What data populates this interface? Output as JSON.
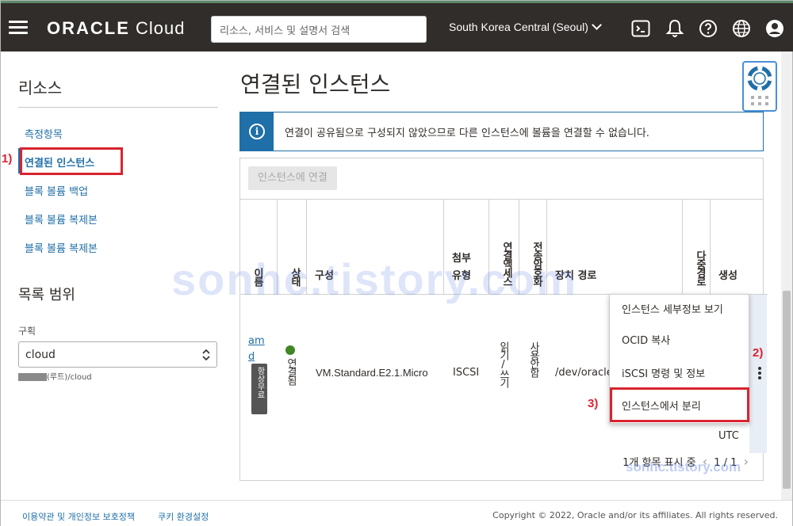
{
  "header": {
    "logo_bold": "ORACLE",
    "logo_light": "Cloud",
    "search_placeholder": "리소스, 서비스 및 설명서 검색",
    "region": "South Korea Central (Seoul)"
  },
  "sidebar": {
    "title": "리소스",
    "items": [
      {
        "label": "측정항목"
      },
      {
        "label": "연결된 인스턴스"
      },
      {
        "label": "블록 볼륨 백업"
      },
      {
        "label": "블록 볼륨 복제본"
      },
      {
        "label": "블록 볼륨 복제본"
      }
    ],
    "scope_title": "목록 범위",
    "compartment_label": "구획",
    "compartment_value": "cloud",
    "compartment_path": "(루트)/cloud"
  },
  "main": {
    "title": "연결된 인스턴스",
    "info_message": "연결이 공유됨으로 구성되지 않았으므로 다른 인스턴스에 볼륨을 연결할 수 없습니다.",
    "attach_button": "인스턴스에 연결",
    "columns": {
      "name": "이름",
      "state": "상태",
      "shape": "구성",
      "attachment_type": "첨부 유형",
      "access": "연결액세스",
      "encryption": "전송암호화",
      "device_path": "장치 경로",
      "multipath": "다중경로",
      "created": "생성"
    },
    "row": {
      "name": "amd",
      "badge": "항상무료",
      "state": "연결됨",
      "shape": "VM.Standard.E2.1.Micro",
      "attachment_type": "ISCSI",
      "access": "읽기/쓰기",
      "encryption": "사용안함",
      "device_path": "/dev/oracle",
      "created_tail": "UTC"
    },
    "pager_text": "1개 항목 표시 중",
    "pager_pages": "1 / 1"
  },
  "menu": {
    "items": [
      {
        "label": "인스턴스 세부정보 보기"
      },
      {
        "label": "OCID 복사"
      },
      {
        "label": "iSCSI 명령 및 정보"
      },
      {
        "label": "인스턴스에서 분리"
      }
    ]
  },
  "annotations": {
    "step1": "1)",
    "step2": "2)",
    "step3": "3)"
  },
  "watermark": "sonhc.tistory.com",
  "footer": {
    "terms": "이용약관 및 개인정보 보호정책",
    "cookies": "쿠키 환경설정",
    "copyright": "Copyright © 2022, Oracle and/or its affiliates. All rights reserved."
  },
  "colors": {
    "topbar": "#312d2a",
    "link": "#1f6fa8",
    "annotation_red": "#d9232f",
    "status_green": "#3f8624"
  }
}
